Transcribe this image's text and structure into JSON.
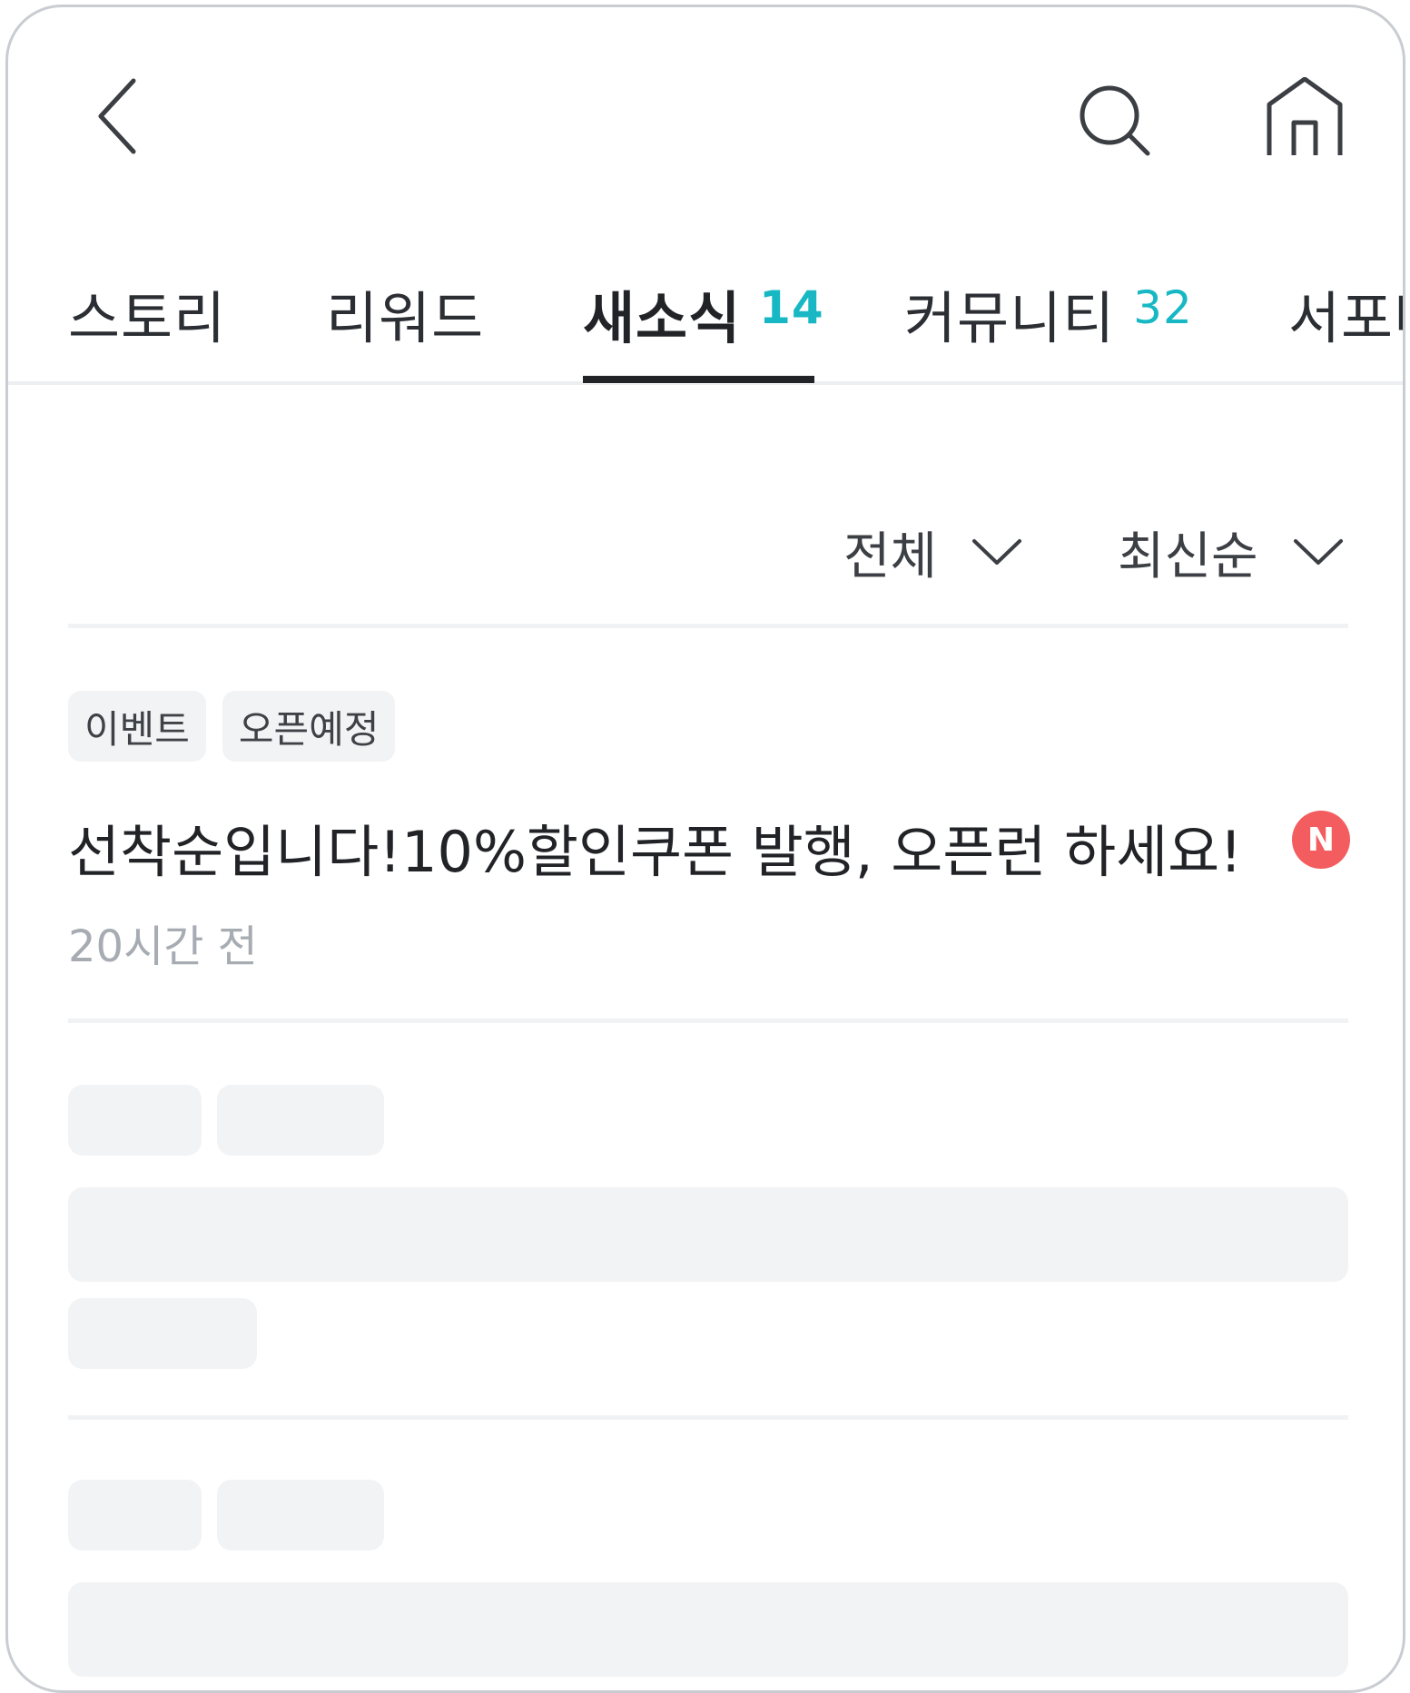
{
  "header": {
    "back_icon": "chevron-left-icon",
    "search_icon": "search-icon",
    "home_icon": "home-icon"
  },
  "tabs": [
    {
      "label": "스토리",
      "count": ""
    },
    {
      "label": "리워드",
      "count": ""
    },
    {
      "label": "새소식",
      "count": "14",
      "active": true
    },
    {
      "label": "커뮤니티",
      "count": "32"
    },
    {
      "label": "서포터",
      "count": ""
    }
  ],
  "filters": {
    "category": "전체",
    "sort": "최신순"
  },
  "post": {
    "tags": [
      "이벤트",
      "오픈예정"
    ],
    "title": "선착순입니다!10%할인쿠폰 발행, 오픈런 하세요!",
    "new_badge": "N",
    "time": "20시간 전"
  },
  "colors": {
    "accent": "#17b8c4",
    "new_badge": "#f35d5f",
    "skeleton": "#f2f3f5"
  }
}
